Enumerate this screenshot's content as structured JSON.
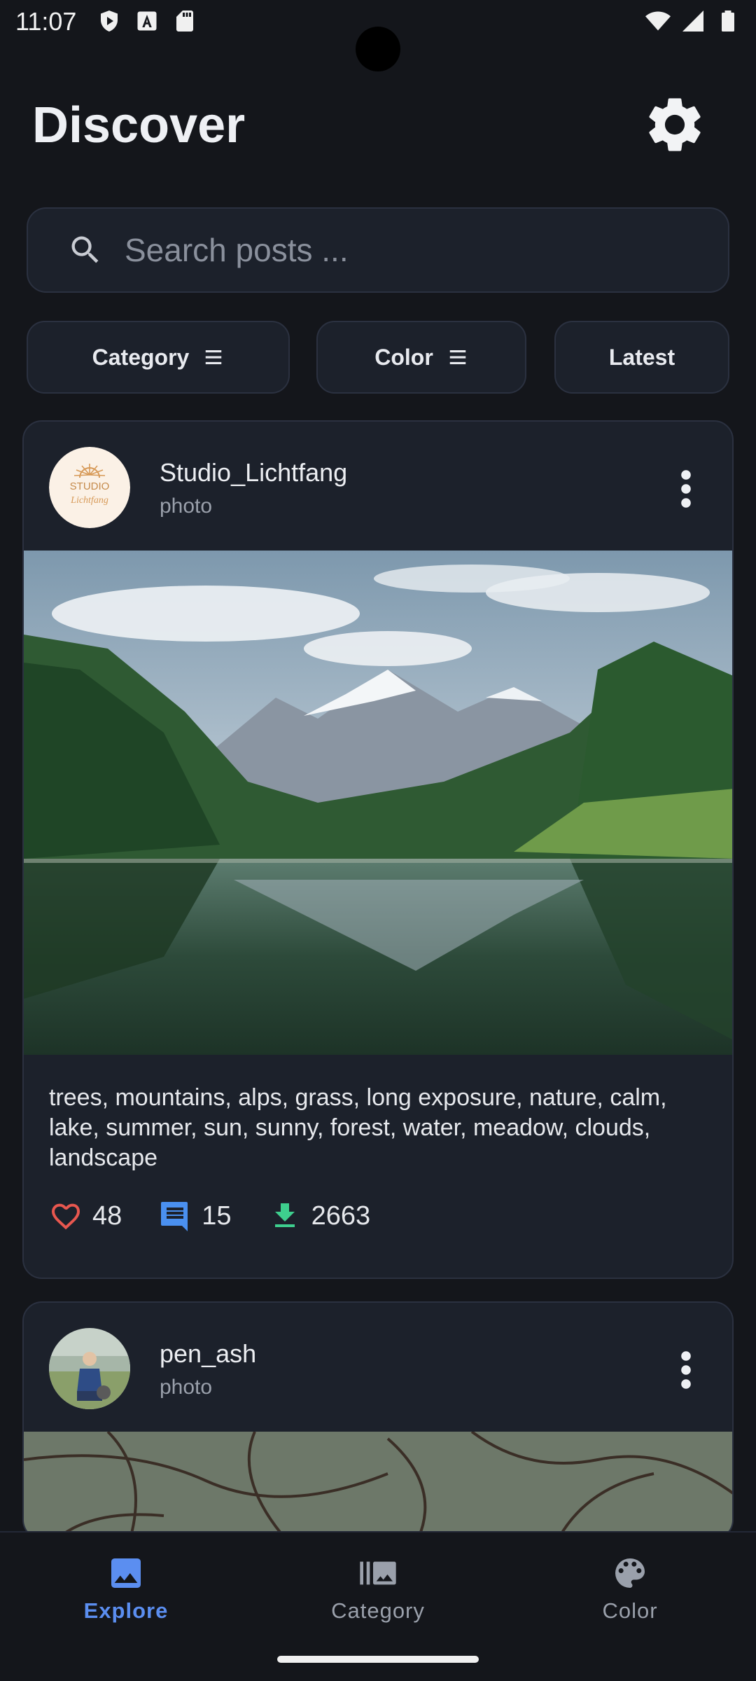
{
  "status_bar": {
    "time": "11:07"
  },
  "header": {
    "title": "Discover"
  },
  "search": {
    "placeholder": "Search posts ...",
    "value": ""
  },
  "filters": [
    {
      "label": "Category"
    },
    {
      "label": "Color"
    },
    {
      "label": "Latest"
    }
  ],
  "posts": [
    {
      "username": "Studio_Lichtfang",
      "type": "photo",
      "tags": "trees, mountains, alps, grass, long exposure, nature, calm, lake, summer, sun, sunny, forest, water, meadow, clouds, landscape",
      "likes": "48",
      "comments": "15",
      "downloads": "2663",
      "avatar_text_1": "STUDIO",
      "avatar_text_2": "Lichtfang"
    },
    {
      "username": "pen_ash",
      "type": "photo"
    }
  ],
  "bottom_nav": {
    "items": [
      {
        "label": "Explore",
        "active": true
      },
      {
        "label": "Category",
        "active": false
      },
      {
        "label": "Color",
        "active": false
      }
    ]
  },
  "colors": {
    "accent": "#5b8ef0",
    "like": "#e8574f",
    "comment": "#4a90f0",
    "download": "#3ecf8e"
  }
}
